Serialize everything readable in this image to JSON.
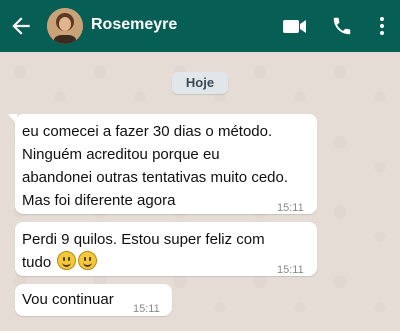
{
  "contact": {
    "name": "Rosemeyre"
  },
  "chat": {
    "date_label": "Hoje",
    "messages": [
      {
        "lines": [
          "eu comecei a fazer 30 dias o método.",
          "Ninguém acreditou porque eu",
          "abandonei outras tentativas muito cedo.",
          "Mas foi diferente agora"
        ],
        "time": "15:11"
      },
      {
        "lines": [
          "Perdi 9 quilos. Estou super feliz com",
          "tudo"
        ],
        "emojis": [
          "smiling-face-emoji",
          "smiling-face-emoji"
        ],
        "time": "15:11"
      },
      {
        "lines": [
          "Vou continuar"
        ],
        "time": "15:11"
      }
    ]
  },
  "colors": {
    "header": "#075e54",
    "chat_bg": "#e5ddd5",
    "bubble": "#ffffff"
  },
  "icons": [
    "back-arrow-icon",
    "video-call-icon",
    "phone-icon",
    "more-options-icon"
  ]
}
